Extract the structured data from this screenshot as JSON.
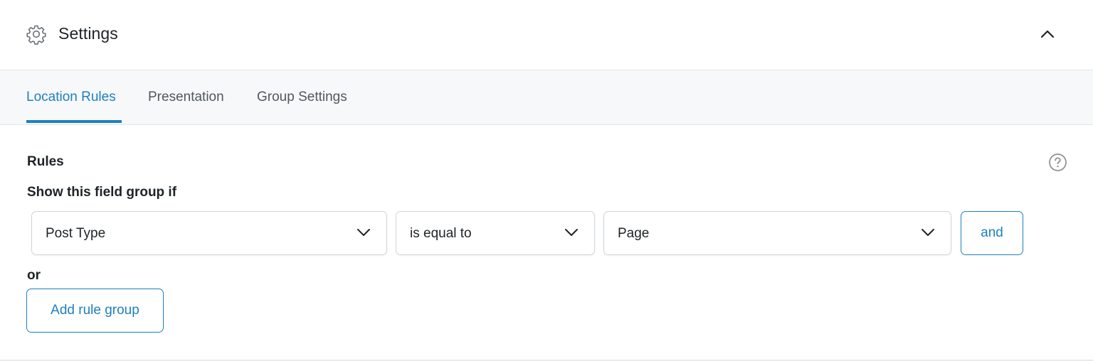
{
  "header": {
    "title": "Settings",
    "icon": "gear-icon",
    "collapse_icon": "chevron-up-icon"
  },
  "tabs": [
    {
      "label": "Location Rules",
      "active": true
    },
    {
      "label": "Presentation",
      "active": false
    },
    {
      "label": "Group Settings",
      "active": false
    }
  ],
  "rules": {
    "label": "Rules",
    "help_icon": "help-circle-icon",
    "show_if_label": "Show this field group if",
    "param_select": {
      "value": "Post Type"
    },
    "operator_select": {
      "value": "is equal to"
    },
    "value_select": {
      "value": "Page"
    },
    "and_button": "and",
    "or_label": "or",
    "add_group_button": "Add rule group"
  },
  "colors": {
    "accent": "#1e7fbf",
    "tab_bar_bg": "#f7f8fa",
    "text": "#1d2327",
    "muted_text": "#50575e",
    "border": "#d0d5da"
  }
}
